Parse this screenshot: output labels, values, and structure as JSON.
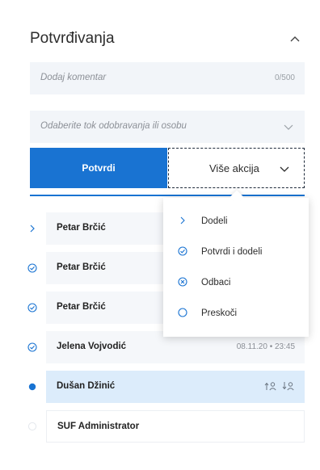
{
  "section": {
    "title": "Potvrđivanja"
  },
  "comment": {
    "placeholder": "Dodaj komentar",
    "counter": "0/500"
  },
  "flow": {
    "placeholder": "Odaberite tok odobravanja ili osobu"
  },
  "actions": {
    "confirm_label": "Potvrdi",
    "more_label": "Više akcija"
  },
  "colors": {
    "accent": "#1973d2",
    "row_bg": "#f5f7fa",
    "active_row_bg": "#dcecfb"
  },
  "steps": [
    {
      "name": "Petar Brčić",
      "status_icon": "chevron-right-icon",
      "meta": ""
    },
    {
      "name": "Petar Brčić",
      "status_icon": "check-circle-icon",
      "meta": ""
    },
    {
      "name": "Petar Brčić",
      "status_icon": "check-circle-icon",
      "meta": ""
    },
    {
      "name": "Jelena Vojvodić",
      "status_icon": "check-circle-icon",
      "meta": "08.11.20 • 23:45"
    },
    {
      "name": "Dušan Džinić",
      "status_icon": "current-dot-icon",
      "meta": ""
    },
    {
      "name": "SUF Administrator",
      "status_icon": "pending-circle-icon",
      "meta": ""
    }
  ],
  "menu": {
    "items": [
      {
        "label": "Dodeli",
        "icon": "chevron-right-icon"
      },
      {
        "label": "Potvrdi i dodeli",
        "icon": "check-circle-icon"
      },
      {
        "label": "Odbaci",
        "icon": "reject-circle-icon"
      },
      {
        "label": "Preskoči",
        "icon": "empty-circle-icon"
      }
    ]
  }
}
